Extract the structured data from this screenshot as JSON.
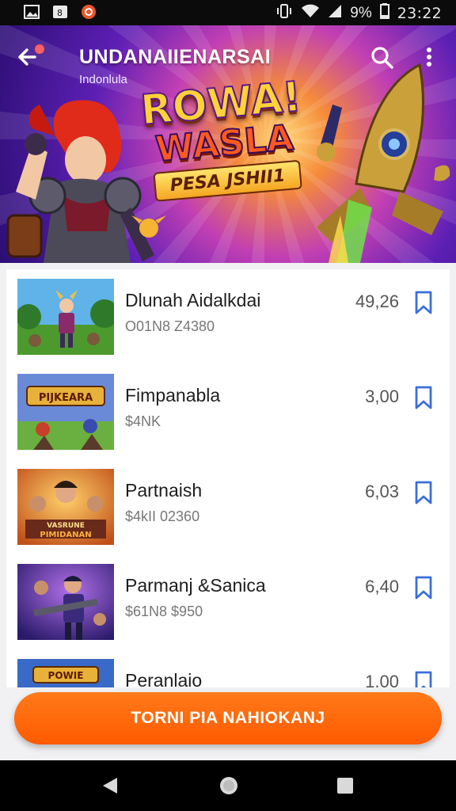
{
  "status_bar": {
    "time": "23:22",
    "battery": "9%",
    "icons": [
      "image-icon",
      "photo-icon",
      "app-notification-icon",
      "vibrate-icon",
      "wifi-icon",
      "signal-icon",
      "battery-icon"
    ]
  },
  "header": {
    "title": "UNDANAIIENARSAI",
    "subtitle": "Indonlula",
    "back_icon": "back-arrow-icon",
    "search_icon": "search-icon",
    "more_icon": "more-vert-icon"
  },
  "banner": {
    "line1": "ROWA!",
    "line2": "WASLA",
    "tag": "PESA JSHII1"
  },
  "list": {
    "items": [
      {
        "title": "Dlunah Aidalkdai",
        "subtitle": "O01N8  Z4380",
        "price": "49,26",
        "bookmark_icon": "bookmark-icon"
      },
      {
        "title": "Fimpanabla",
        "subtitle": "$4NK",
        "price": "3,00",
        "bookmark_icon": "bookmark-icon"
      },
      {
        "title": "Partnaish",
        "subtitle": "$4kII  02360",
        "price": "6,03",
        "bookmark_icon": "bookmark-icon"
      },
      {
        "title": "Parmanj &Sanica",
        "subtitle": "$61N8  $950",
        "price": "6,40",
        "bookmark_icon": "bookmark-icon"
      },
      {
        "title": "Peranlaio",
        "subtitle": "",
        "price": "1,00",
        "bookmark_icon": "bookmark-icon"
      }
    ],
    "thumb_texts": [
      "",
      "PIJKEARA",
      "",
      "",
      "POWIE",
      "VASRUNE",
      "PIMIDANAN"
    ]
  },
  "cta": {
    "label": "TORNI PIA NAHIOKANJ"
  },
  "colors": {
    "accent": "#ff6a00",
    "bookmark": "#3b6fd8",
    "banner_purple": "#5d1fb4"
  },
  "nav_bar": {
    "icons": [
      "nav-back-icon",
      "nav-home-icon",
      "nav-recent-icon"
    ]
  }
}
